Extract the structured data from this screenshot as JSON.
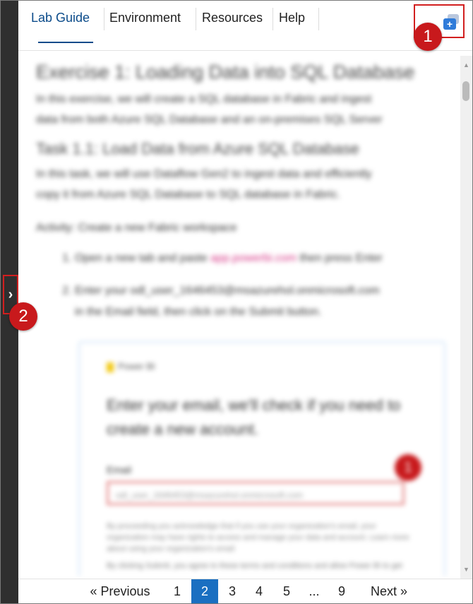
{
  "tabs": [
    {
      "label": "Lab Guide",
      "active": true
    },
    {
      "label": "Environment",
      "active": false
    },
    {
      "label": "Resources",
      "active": false
    },
    {
      "label": "Help",
      "active": false
    }
  ],
  "callouts": {
    "one": "1",
    "two": "2"
  },
  "icons": {
    "expand": "chevron-right-icon",
    "open_new_window": "new-window-icon",
    "new_window_glyph": "+"
  },
  "content": {
    "title": "Exercise 1: Loading Data into SQL Database",
    "intro_1": "In this exercise, we will create a SQL database in Fabric and ingest",
    "intro_2": "data from both Azure SQL Database and an on-premises SQL Server",
    "task_title": "Task 1.1: Load Data from Azure SQL Database",
    "task_1": "In this task, we will use Dataflow Gen2 to ingest data and efficiently",
    "task_2": "copy it from Azure SQL Database to SQL database in Fabric.",
    "activity": "Activity: Create a new Fabric workspace",
    "step1_a": "Open a new tab and paste",
    "step1_link": "app.powerbi.com",
    "step1_b": "then press Enter",
    "step2_a": "Enter your odl_user_1646453@msazurehol.onmicrosoft.com",
    "step2_b": "in the Email field, then click on the Submit button."
  },
  "card": {
    "brand": "Power BI",
    "question": "Enter your email, we'll check if you need to create a new account.",
    "email_label": "Email",
    "email_value": "odl_user_1646453@msazurehol.onmicrosoft.com",
    "callout": "1",
    "fine_print": "By proceeding you acknowledge that if you use your organization's email, your organization may have rights to access and manage your data and account. Learn more about using your organization's email",
    "submit_note": "By clicking Submit, you agree to these terms and conditions and allow Power BI to get"
  },
  "pager": {
    "prev": "«  Previous",
    "pages": [
      "1",
      "2",
      "3",
      "4",
      "5",
      "...",
      "9"
    ],
    "current": "2",
    "next": "Next  »"
  },
  "colors": {
    "accent": "#0b4b8a",
    "active_page": "#1a6fc1",
    "callout_red": "#c8191c",
    "sidebar": "#2f2f2f"
  }
}
